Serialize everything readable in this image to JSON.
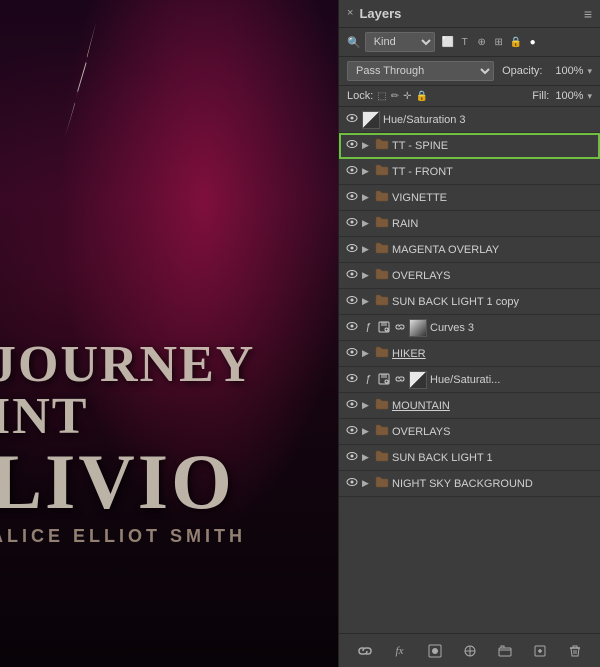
{
  "background": {
    "title_line1": "JOURNEY INT",
    "title_line2": "LIVIO",
    "author": "ALICE ELLIOT SMITH"
  },
  "panel": {
    "title": "Layers",
    "close_label": "×",
    "menu_label": "≡",
    "kind_label": "Kind",
    "blend_mode": "Pass Through",
    "opacity_label": "Opacity:",
    "opacity_value": "100%",
    "lock_label": "Lock:",
    "fill_label": "Fill:",
    "fill_value": "100%",
    "chevron": "▾"
  },
  "layers": [
    {
      "id": 1,
      "name": "Hue/Saturation 3",
      "type": "adjustment",
      "has_thumb": true,
      "eye": true,
      "has_link": true,
      "has_special": false,
      "selected": false,
      "highlighted": false,
      "underlined": false
    },
    {
      "id": 2,
      "name": "TT - SPINE",
      "type": "folder",
      "has_thumb": false,
      "eye": true,
      "has_link": false,
      "has_special": false,
      "selected": false,
      "highlighted": true,
      "underlined": false
    },
    {
      "id": 3,
      "name": "TT - FRONT",
      "type": "folder",
      "has_thumb": false,
      "eye": true,
      "has_link": false,
      "has_special": false,
      "selected": false,
      "highlighted": false,
      "underlined": false
    },
    {
      "id": 4,
      "name": "VIGNETTE",
      "type": "folder",
      "has_thumb": false,
      "eye": true,
      "has_link": false,
      "has_special": false,
      "selected": false,
      "highlighted": false,
      "underlined": false
    },
    {
      "id": 5,
      "name": "RAIN",
      "type": "folder",
      "has_thumb": false,
      "eye": true,
      "has_link": false,
      "has_special": false,
      "selected": false,
      "highlighted": false,
      "underlined": false
    },
    {
      "id": 6,
      "name": "MAGENTA OVERLAY",
      "type": "folder",
      "has_thumb": false,
      "eye": true,
      "has_link": false,
      "has_special": false,
      "selected": false,
      "highlighted": false,
      "underlined": false
    },
    {
      "id": 7,
      "name": "OVERLAYS",
      "type": "folder",
      "has_thumb": false,
      "eye": true,
      "has_link": false,
      "has_special": false,
      "selected": false,
      "highlighted": false,
      "underlined": false
    },
    {
      "id": 8,
      "name": "SUN BACK LIGHT 1 copy",
      "type": "folder",
      "has_thumb": false,
      "eye": true,
      "has_link": false,
      "has_special": false,
      "selected": false,
      "highlighted": false,
      "underlined": false
    },
    {
      "id": 9,
      "name": "Curves 3",
      "type": "adjustment_curves",
      "has_thumb": true,
      "eye": true,
      "has_link": true,
      "has_special": true,
      "selected": false,
      "highlighted": false,
      "underlined": false
    },
    {
      "id": 10,
      "name": "HIKER",
      "type": "folder",
      "has_thumb": false,
      "eye": true,
      "has_link": false,
      "has_special": false,
      "selected": false,
      "highlighted": false,
      "underlined": true
    },
    {
      "id": 11,
      "name": "Hue/Saturati...",
      "type": "adjustment",
      "has_thumb": true,
      "eye": true,
      "has_link": true,
      "has_special": true,
      "selected": false,
      "highlighted": false,
      "underlined": false
    },
    {
      "id": 12,
      "name": "MOUNTAIN",
      "type": "folder",
      "has_thumb": false,
      "eye": true,
      "has_link": false,
      "has_special": false,
      "selected": false,
      "highlighted": false,
      "underlined": true
    },
    {
      "id": 13,
      "name": "OVERLAYS",
      "type": "folder",
      "has_thumb": false,
      "eye": true,
      "has_link": false,
      "has_special": false,
      "selected": false,
      "highlighted": false,
      "underlined": false
    },
    {
      "id": 14,
      "name": "SUN BACK LIGHT 1",
      "type": "folder",
      "has_thumb": false,
      "eye": true,
      "has_link": false,
      "has_special": false,
      "selected": false,
      "highlighted": false,
      "underlined": false
    },
    {
      "id": 15,
      "name": "NIGHT SKY BACKGROUND",
      "type": "folder",
      "has_thumb": false,
      "eye": true,
      "has_link": false,
      "has_special": false,
      "selected": false,
      "highlighted": false,
      "underlined": false
    }
  ],
  "footer": {
    "link_icon": "🔗",
    "fx_label": "fx",
    "circle_icon": "◉",
    "brush_icon": "⬤",
    "folder_icon": "📁",
    "new_icon": "🗋",
    "trash_icon": "🗑"
  }
}
